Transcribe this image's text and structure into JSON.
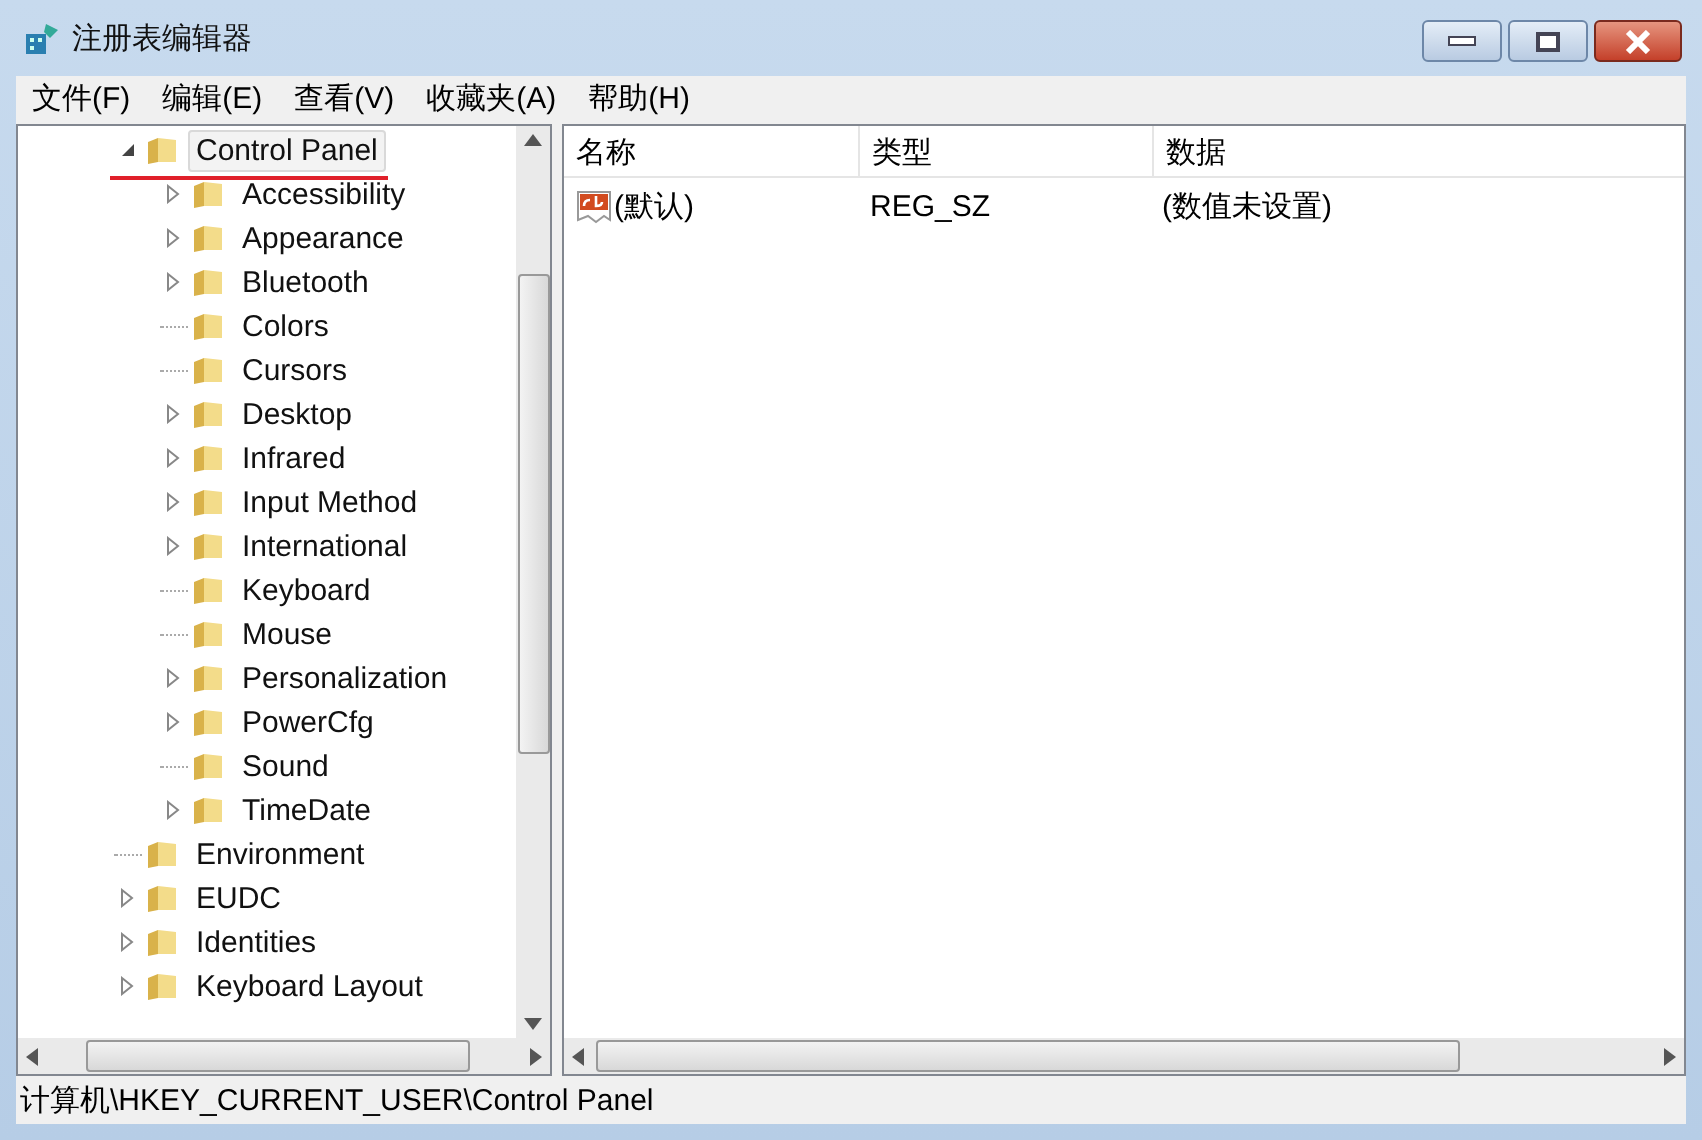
{
  "window": {
    "title": "注册表编辑器"
  },
  "menu": [
    "文件(F)",
    "编辑(E)",
    "查看(V)",
    "收藏夹(A)",
    "帮助(H)"
  ],
  "tree": {
    "items": [
      {
        "label": "Control Panel",
        "expandable": true,
        "expanded": true,
        "selected": true,
        "underlined": true,
        "children": [
          {
            "label": "Accessibility",
            "expandable": true,
            "expanded": false,
            "selected": false
          },
          {
            "label": "Appearance",
            "expandable": true,
            "expanded": false,
            "selected": false
          },
          {
            "label": "Bluetooth",
            "expandable": true,
            "expanded": false,
            "selected": false
          },
          {
            "label": "Colors",
            "expandable": false,
            "selected": false
          },
          {
            "label": "Cursors",
            "expandable": false,
            "selected": false
          },
          {
            "label": "Desktop",
            "expandable": true,
            "expanded": false,
            "selected": false
          },
          {
            "label": "Infrared",
            "expandable": true,
            "expanded": false,
            "selected": false
          },
          {
            "label": "Input Method",
            "expandable": true,
            "expanded": false,
            "selected": false
          },
          {
            "label": "International",
            "expandable": true,
            "expanded": false,
            "selected": false
          },
          {
            "label": "Keyboard",
            "expandable": false,
            "selected": false
          },
          {
            "label": "Mouse",
            "expandable": false,
            "selected": false
          },
          {
            "label": "Personalization",
            "expandable": true,
            "expanded": false,
            "selected": false
          },
          {
            "label": "PowerCfg",
            "expandable": true,
            "expanded": false,
            "selected": false
          },
          {
            "label": "Sound",
            "expandable": false,
            "selected": false
          },
          {
            "label": "TimeDate",
            "expandable": true,
            "expanded": false,
            "selected": false
          }
        ]
      },
      {
        "label": "Environment",
        "expandable": false,
        "selected": false
      },
      {
        "label": "EUDC",
        "expandable": true,
        "expanded": false,
        "selected": false
      },
      {
        "label": "Identities",
        "expandable": true,
        "expanded": false,
        "selected": false
      },
      {
        "label": "Keyboard Layout",
        "expandable": true,
        "expanded": false,
        "selected": false
      }
    ]
  },
  "table": {
    "columns": [
      "名称",
      "类型",
      "数据"
    ],
    "rows": [
      {
        "kind": "string",
        "cells": [
          "(默认)",
          "REG_SZ",
          "(数值未设置)"
        ]
      }
    ]
  },
  "status_bar": "计算机\\HKEY_CURRENT_USER\\Control Panel"
}
